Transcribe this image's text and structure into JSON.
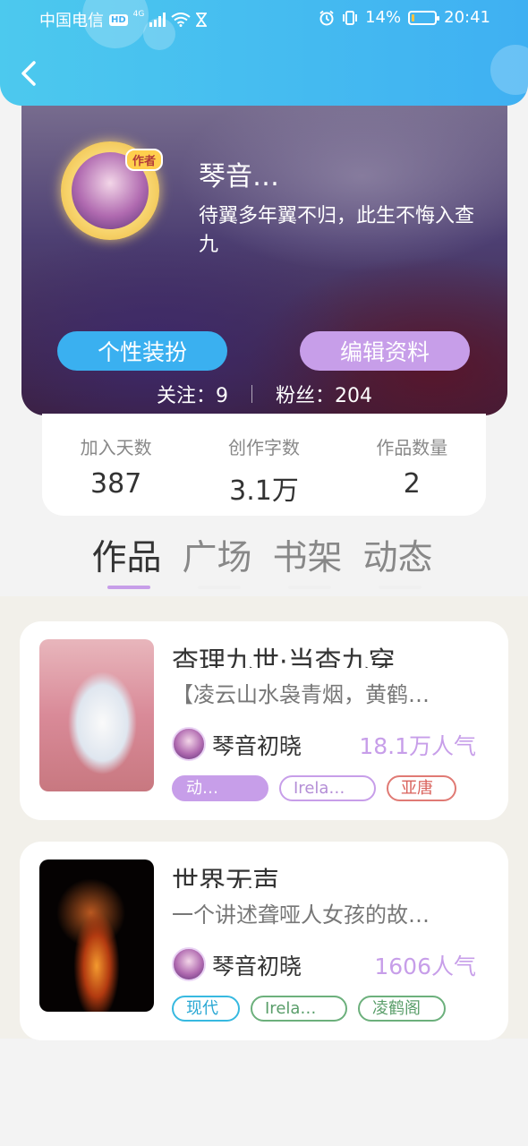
{
  "status_bar": {
    "carrier": "中国电信",
    "hd": "HD",
    "network": "4G",
    "battery": "14%",
    "battery_level": 0.14,
    "time": "20:41"
  },
  "profile": {
    "author_badge": "作者",
    "nickname": "琴音…",
    "bio": "待翼多年翼不归，此生不悔入查九",
    "dress_button": "个性装扮",
    "edit_button": "编辑资料",
    "following_label": "关注：9",
    "fans_label": "粉丝：204"
  },
  "stats": [
    {
      "label": "加入天数",
      "value": "387"
    },
    {
      "label": "创作字数",
      "value": "3.1万"
    },
    {
      "label": "作品数量",
      "value": "2"
    }
  ],
  "tabs": [
    {
      "label": "作品",
      "active": true
    },
    {
      "label": "广场",
      "active": false
    },
    {
      "label": "书架",
      "active": false
    },
    {
      "label": "动态",
      "active": false
    }
  ],
  "books": [
    {
      "title": "杳理九世·当杳九穿",
      "description": "【凌云山水袅青烟，黄鹤…",
      "author": "琴音初晓",
      "popularity": "18.1万人气",
      "tags": [
        {
          "label": "动…",
          "style": "filled-purple"
        },
        {
          "label": "Irela…",
          "style": "outline-purple"
        },
        {
          "label": "亚唐",
          "style": "outline-red"
        }
      ]
    },
    {
      "title": "世界无声",
      "description": "一个讲述聋哑人女孩的故…",
      "author": "琴音初晓",
      "popularity": "1606人气",
      "tags": [
        {
          "label": "现代",
          "style": "outline-cyan"
        },
        {
          "label": "Irela…",
          "style": "outline-green"
        },
        {
          "label": "凌鹤阁",
          "style": "outline-green"
        }
      ]
    }
  ],
  "colors": {
    "header": "#3fb0f2",
    "accent_purple": "#c79ee9",
    "accent_blue": "#3ab0f0",
    "tag_red": "#e07a74",
    "tag_cyan": "#37b9e0",
    "tag_green": "#6cb07c"
  },
  "icons": [
    "back-arrow-icon",
    "signal-icon",
    "wifi-icon",
    "hourglass-icon",
    "alarm-icon",
    "vibrate-icon",
    "battery-icon"
  ]
}
